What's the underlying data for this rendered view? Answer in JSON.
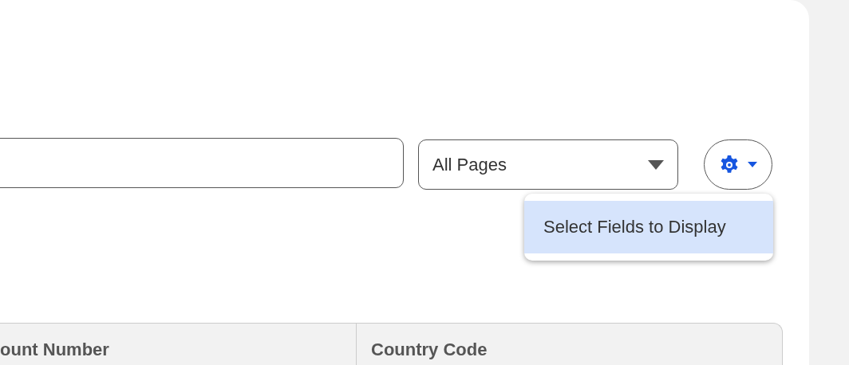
{
  "toolbar": {
    "page_filter": {
      "value": "All Pages"
    },
    "settings_menu": {
      "expanded": true,
      "items": [
        {
          "label": "Select Fields to Display",
          "selected": true
        }
      ]
    }
  },
  "table": {
    "columns": [
      "ount Number",
      "Country Code"
    ]
  }
}
